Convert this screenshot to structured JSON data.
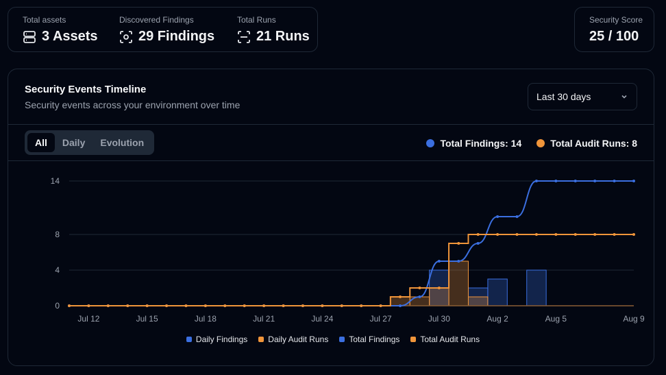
{
  "stats": [
    {
      "label": "Total assets",
      "value": "3 Assets",
      "icon": "server-icon"
    },
    {
      "label": "Discovered Findings",
      "value": "29 Findings",
      "icon": "scan-eye-icon"
    },
    {
      "label": "Total Runs",
      "value": "21 Runs",
      "icon": "scan-icon"
    }
  ],
  "score": {
    "label": "Security Score",
    "value": "25 / 100"
  },
  "timeline": {
    "title": "Security Events Timeline",
    "subtitle": "Security events across your environment over time",
    "range": "Last 30 days",
    "tabs": [
      "All",
      "Daily",
      "Evolution"
    ],
    "active_tab": "All",
    "totals": [
      {
        "label": "Total Findings: 14",
        "color": "#3b6fe0"
      },
      {
        "label": "Total Audit Runs: 8",
        "color": "#f0953a"
      }
    ]
  },
  "colors": {
    "findings": "#3b6fe0",
    "audit": "#f0953a",
    "grid": "#1f2937",
    "axis_text": "#9ca3af"
  },
  "chart_data": {
    "type": "line",
    "x": [
      "Jul 11",
      "Jul 12",
      "Jul 13",
      "Jul 14",
      "Jul 15",
      "Jul 16",
      "Jul 17",
      "Jul 18",
      "Jul 19",
      "Jul 20",
      "Jul 21",
      "Jul 22",
      "Jul 23",
      "Jul 24",
      "Jul 25",
      "Jul 26",
      "Jul 27",
      "Jul 28",
      "Jul 29",
      "Jul 30",
      "Jul 31",
      "Aug 1",
      "Aug 2",
      "Aug 3",
      "Aug 4",
      "Aug 5",
      "Aug 6",
      "Aug 7",
      "Aug 8",
      "Aug 9"
    ],
    "x_ticks": [
      "Jul 12",
      "Jul 15",
      "Jul 18",
      "Jul 21",
      "Jul 24",
      "Jul 27",
      "Jul 30",
      "Aug 2",
      "Aug 5",
      "Aug 9"
    ],
    "y_ticks": [
      0,
      4,
      8,
      14
    ],
    "ylim": [
      0,
      14
    ],
    "series": [
      {
        "name": "Daily Findings",
        "kind": "bar",
        "color_key": "findings",
        "values": [
          0,
          0,
          0,
          0,
          0,
          0,
          0,
          0,
          0,
          0,
          0,
          0,
          0,
          0,
          0,
          0,
          0,
          0,
          0,
          4,
          0,
          2,
          3,
          0,
          4,
          0,
          0,
          0,
          0,
          0
        ]
      },
      {
        "name": "Daily Audit Runs",
        "kind": "bar",
        "color_key": "audit",
        "values": [
          0,
          0,
          0,
          0,
          0,
          0,
          0,
          0,
          0,
          0,
          0,
          0,
          0,
          0,
          0,
          0,
          0,
          1,
          1,
          2,
          5,
          1,
          0,
          0,
          0,
          0,
          0,
          0,
          0,
          0
        ]
      },
      {
        "name": "Total Findings",
        "kind": "line",
        "color_key": "findings",
        "values": [
          0,
          0,
          0,
          0,
          0,
          0,
          0,
          0,
          0,
          0,
          0,
          0,
          0,
          0,
          0,
          0,
          0,
          0,
          1,
          5,
          5,
          7,
          10,
          10,
          14,
          14,
          14,
          14,
          14,
          14
        ]
      },
      {
        "name": "Total Audit Runs",
        "kind": "step",
        "color_key": "audit",
        "values": [
          0,
          0,
          0,
          0,
          0,
          0,
          0,
          0,
          0,
          0,
          0,
          0,
          0,
          0,
          0,
          0,
          0,
          1,
          2,
          2,
          7,
          8,
          8,
          8,
          8,
          8,
          8,
          8,
          8,
          8
        ]
      }
    ],
    "legend": [
      "Daily Findings",
      "Daily Audit Runs",
      "Total Findings",
      "Total Audit Runs"
    ]
  }
}
